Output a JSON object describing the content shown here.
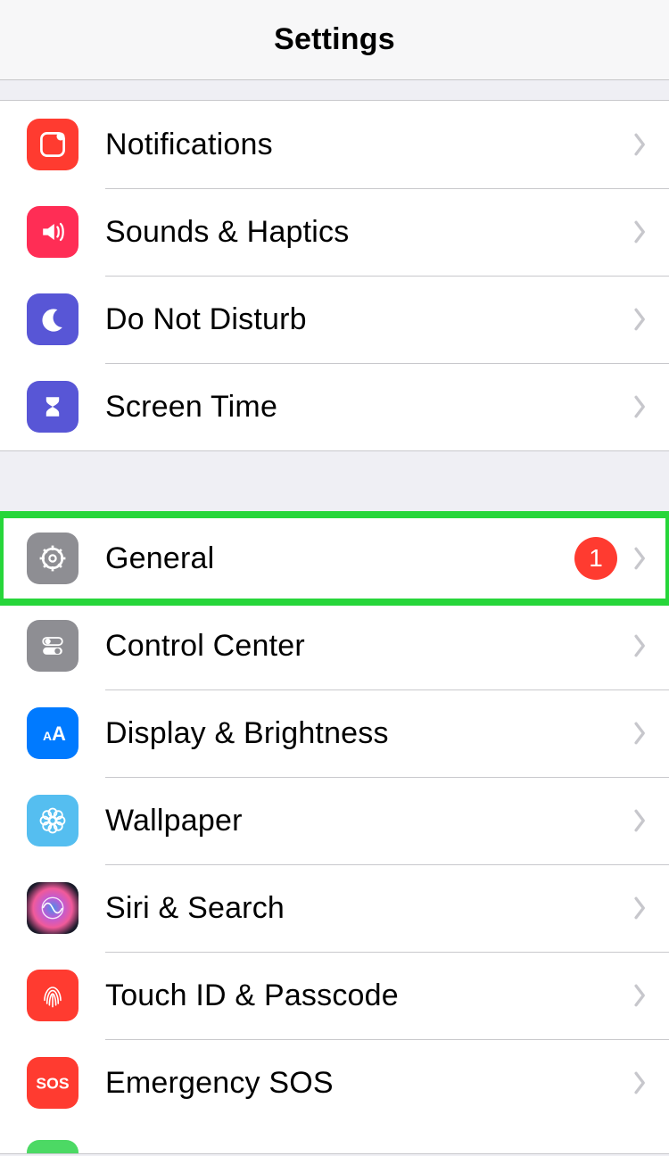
{
  "header": {
    "title": "Settings"
  },
  "groups": [
    {
      "rows": [
        {
          "id": "notifications",
          "label": "Notifications",
          "icon": "notifications-icon",
          "icon_bg": "#ff3b30"
        },
        {
          "id": "sounds",
          "label": "Sounds & Haptics",
          "icon": "speaker-icon",
          "icon_bg": "#ff2d55"
        },
        {
          "id": "dnd",
          "label": "Do Not Disturb",
          "icon": "moon-icon",
          "icon_bg": "#5856d6"
        },
        {
          "id": "screentime",
          "label": "Screen Time",
          "icon": "hourglass-icon",
          "icon_bg": "#5856d6"
        }
      ]
    },
    {
      "rows": [
        {
          "id": "general",
          "label": "General",
          "icon": "gear-icon",
          "icon_bg": "#8e8e93",
          "badge": "1",
          "highlight": true
        },
        {
          "id": "controlcenter",
          "label": "Control Center",
          "icon": "toggles-icon",
          "icon_bg": "#8e8e93"
        },
        {
          "id": "display",
          "label": "Display & Brightness",
          "icon": "aa-icon",
          "icon_bg": "#007aff"
        },
        {
          "id": "wallpaper",
          "label": "Wallpaper",
          "icon": "flower-icon",
          "icon_bg": "#55bef0"
        },
        {
          "id": "siri",
          "label": "Siri & Search",
          "icon": "siri-icon",
          "icon_bg": "#1b1b2a"
        },
        {
          "id": "touchid",
          "label": "Touch ID & Passcode",
          "icon": "fingerprint-icon",
          "icon_bg": "#ff3b30"
        },
        {
          "id": "sos",
          "label": "Emergency SOS",
          "icon": "sos-icon",
          "icon_bg": "#ff3b30"
        }
      ]
    }
  ],
  "partial_next": {
    "icon_bg": "#4cd964"
  }
}
